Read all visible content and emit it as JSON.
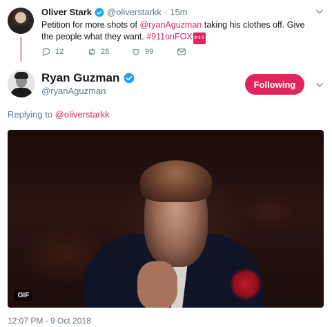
{
  "parent_tweet": {
    "name": "Oliver Stark",
    "handle": "@oliverstarkk",
    "separator": "·",
    "time": "15m",
    "text_before": "Petition for more shots of ",
    "mention": "@ryanAguzman",
    "text_after": " taking his clothes off. Give the people what they want. ",
    "hashtag": "#911onFOX",
    "hashtag_badge": "9-1-1",
    "replies": "12",
    "retweets": "28",
    "likes": "99"
  },
  "main_tweet": {
    "name": "Ryan Guzman",
    "handle": "@ryanAguzman",
    "follow_label": "Following",
    "replying_prefix": "Replying to ",
    "replying_to": "@oliverstarkk",
    "media_badge": "GIF",
    "timestamp": "12:07 PM - 9 Oct 2018"
  },
  "colors": {
    "accent": "#e0245e",
    "verified": "#1da1f2",
    "muted": "#657786",
    "thread_line": "#e8b4c8"
  },
  "icons": [
    "verified-badge-icon",
    "chevron-down-icon",
    "reply-icon",
    "retweet-icon",
    "like-icon",
    "direct-message-icon"
  ]
}
